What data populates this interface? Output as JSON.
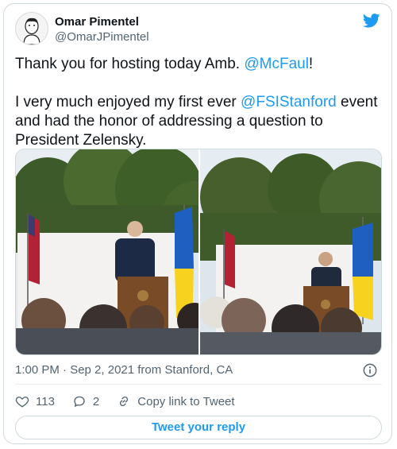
{
  "author": {
    "name": "Omar Pimentel",
    "handle": "@OmarJPimentel"
  },
  "tweet": {
    "line1_pre": "Thank you for hosting today Amb. ",
    "line1_mention": "@McFaul",
    "line1_post": "!",
    "para2_pre": "I very much enjoyed my first ever ",
    "para2_mention": "@FSIStanford",
    "para2_post": " event and had the honor of addressing a question to President Zelensky."
  },
  "meta": {
    "timestamp": "1:00 PM · Sep 2, 2021 from Stanford, CA"
  },
  "actions": {
    "like_count": "113",
    "reply_count": "2",
    "copy_link_label": "Copy link to Tweet"
  },
  "reply_button_label": "Tweet your reply",
  "colors": {
    "accent": "#1d9bf0",
    "muted": "#536471",
    "text": "#0f1419"
  },
  "icons": [
    "twitter-bird-icon",
    "heart-icon",
    "reply-bubble-icon",
    "link-icon",
    "info-icon"
  ]
}
